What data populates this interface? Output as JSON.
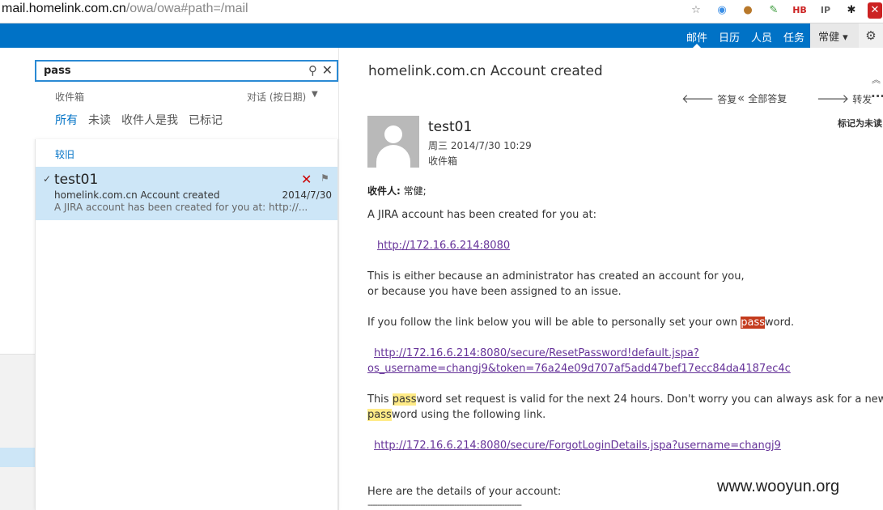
{
  "browser": {
    "url_host": "mail.homelink.com.cn",
    "url_path": "/owa/owa#path=/mail"
  },
  "nav": {
    "links": [
      "邮件",
      "日历",
      "人员",
      "任务"
    ],
    "active": 0,
    "user": "常健 ▾"
  },
  "search": {
    "value": "pass"
  },
  "list": {
    "folder": "收件箱",
    "sort": "对话 (按日期)",
    "filters": [
      "所有",
      "未读",
      "收件人是我",
      "已标记"
    ],
    "group": "较旧",
    "message": {
      "sender": "test01",
      "subject": "homelink.com.cn Account created",
      "date": "2014/7/30",
      "preview": "A JIRA account has been created for you at:  http://..."
    }
  },
  "reading": {
    "subject": "homelink.com.cn Account created",
    "actions": {
      "reply": "答复",
      "reply_all": "全部答复",
      "forward": "转发"
    },
    "mark_unread": "标记为未读",
    "from": "test01",
    "sent": "周三 2014/7/30 10:29",
    "folder": "收件箱",
    "to_label": "收件人:",
    "to_value": "常健;",
    "p1": "A JIRA account has been created for you at:",
    "link1": "http://172.16.6.214:8080",
    "p2a": "This is either because an administrator has created an account for you,",
    "p2b": "or because you have been assigned to an issue.",
    "p3_before": "If you follow the link below you will be able to personally set your own ",
    "p3_hl": "pass",
    "p3_after": "word.",
    "link2a": "http://172.16.6.214:8080/secure/ResetPassword!default.jspa?",
    "link2b": "os_username=changj9&token=76a24e09d707af5add47bef17ecc84da4187ec4c",
    "p4a_before": "This ",
    "p4a_hl": "pass",
    "p4a_after": "word set request is valid for the next 24 hours.  Don't worry you can always ask for a new",
    "p4b_hl": "pass",
    "p4b_after": "word using the following link.",
    "link3": "http://172.16.6.214:8080/secure/ForgotLoginDetails.jspa?username=changj9",
    "p5": "Here are the details of your account:",
    "p6": "----------------------------------------------------------------"
  },
  "watermark": "www.wooyun.org",
  "colors": {
    "nav_blue": "#0072c6",
    "selected_row": "#cde6f7",
    "highlight_active": "#c43b1d",
    "highlight": "#ffeb87"
  }
}
